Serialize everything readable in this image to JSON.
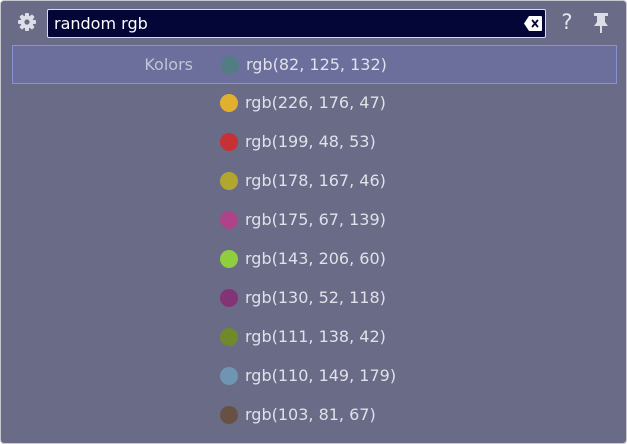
{
  "search": {
    "value": "random rgb",
    "placeholder": ""
  },
  "toolbar": {
    "settings_icon": "gear-icon",
    "clear_icon": "backspace-clear-icon",
    "help_label": "?",
    "pin_icon": "pin-icon"
  },
  "results": {
    "source_label": "Kolors",
    "selected_index": 0,
    "items": [
      {
        "label": "rgb(82, 125, 132)",
        "color": "#527d84"
      },
      {
        "label": "rgb(226, 176, 47)",
        "color": "#e2b02f"
      },
      {
        "label": "rgb(199, 48, 53)",
        "color": "#c73035"
      },
      {
        "label": "rgb(178, 167, 46)",
        "color": "#b2a72e"
      },
      {
        "label": "rgb(175, 67, 139)",
        "color": "#af438b"
      },
      {
        "label": "rgb(143, 206, 60)",
        "color": "#8fce3c"
      },
      {
        "label": "rgb(130, 52, 118)",
        "color": "#823476"
      },
      {
        "label": "rgb(111, 138, 42)",
        "color": "#6f8a2a"
      },
      {
        "label": "rgb(110, 149, 179)",
        "color": "#6e95b3"
      },
      {
        "label": "rgb(103, 81, 67)",
        "color": "#675143"
      }
    ]
  }
}
